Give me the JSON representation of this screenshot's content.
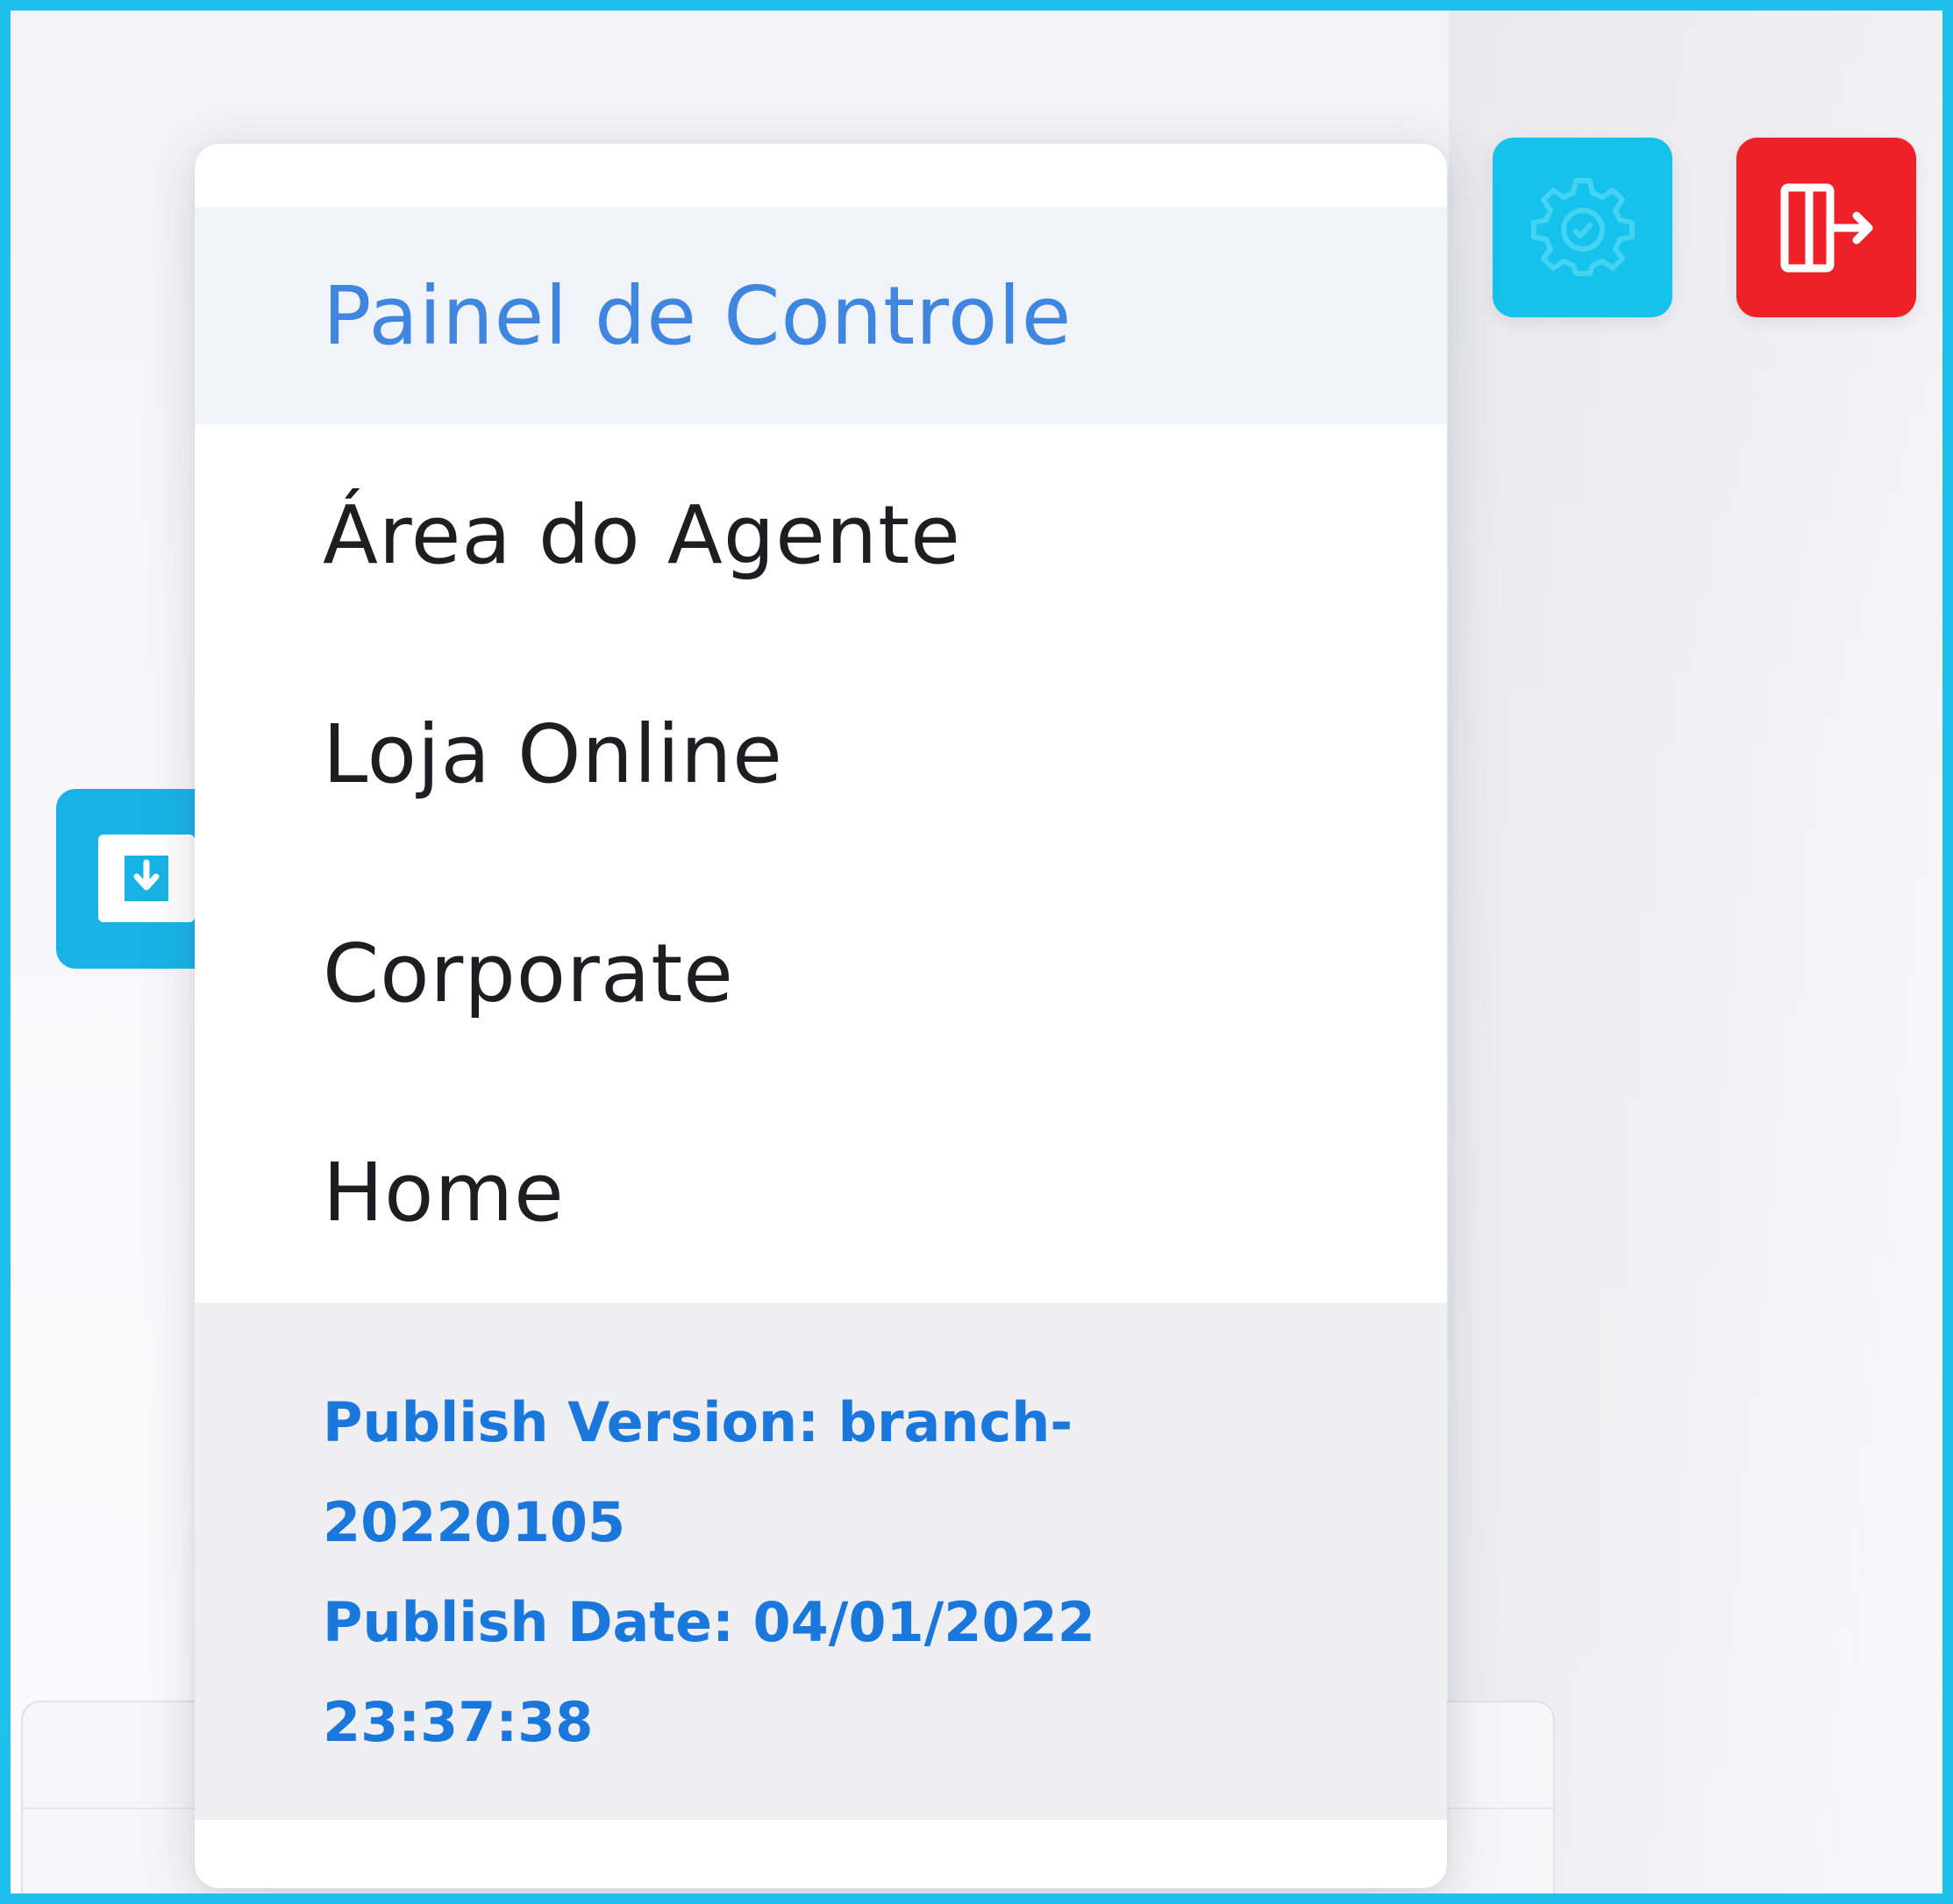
{
  "menu": {
    "items": [
      {
        "label": "Painel de Controle",
        "active": true
      },
      {
        "label": "Área do Agente",
        "active": false
      },
      {
        "label": "Loja Online",
        "active": false
      },
      {
        "label": "Corporate",
        "active": false
      },
      {
        "label": "Home",
        "active": false
      }
    ]
  },
  "version_info": {
    "lines": [
      "Publish Version: branch-",
      "20220105",
      "Publish Date: 04/01/2022",
      "23:37:38"
    ]
  },
  "toolbar": {
    "settings_icon": "gear-icon",
    "logout_icon": "logout-icon",
    "download_icon": "download-icon"
  },
  "colors": {
    "frame_border": "#1fbfee",
    "settings_button": "#14c2ec",
    "logout_button": "#ef2128",
    "active_item_text": "#3f86e0",
    "version_text": "#1a78dc",
    "download_button": "#18b3e6"
  }
}
